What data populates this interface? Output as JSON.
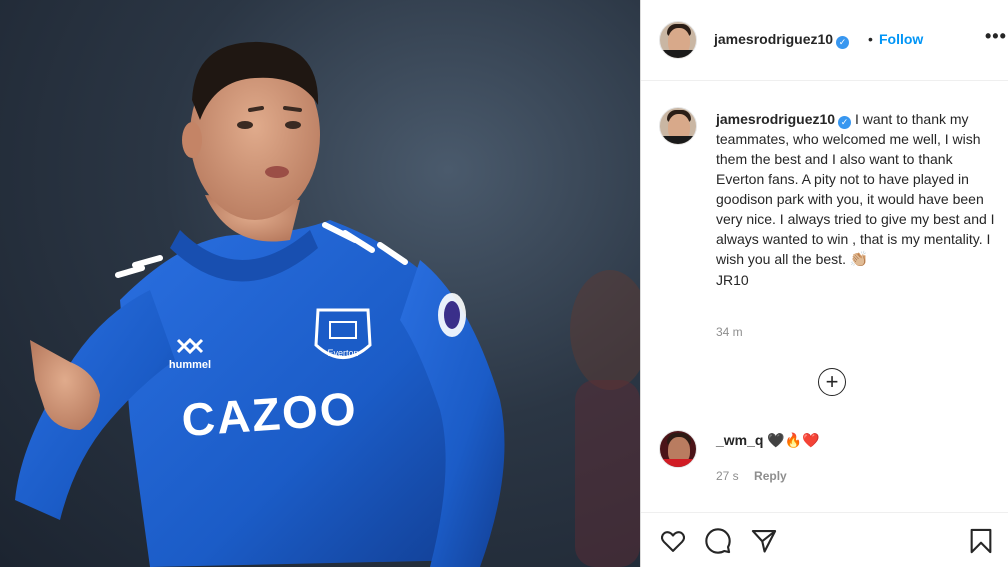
{
  "post": {
    "username": "jamesrodriguez10",
    "verified_icon": "verified-badge-icon",
    "dot": "•",
    "follow_label": "Follow",
    "more_icon": "•••",
    "photo_text": {
      "sponsor": "CAZOO",
      "club_badge": "Everton",
      "kit_brand": "hummel"
    }
  },
  "caption": {
    "username": "jamesrodriguez10",
    "text": "I want to thank my teammates, who welcomed me well, I wish them the best and I also want to thank Everton fans. A pity not to have played in goodison park with you, it would have been very nice. I always tried to give my best and I always wanted to win , that is my mentality. I wish you all the best.",
    "emoji": "👏🏼",
    "signature": "JR10",
    "time": "34 m"
  },
  "load_more": {
    "icon": "plus-circle-icon",
    "symbol": "+"
  },
  "comments": [
    {
      "username": "_wm_q",
      "text": "🖤🔥❤️",
      "time": "27 s",
      "reply_label": "Reply"
    }
  ],
  "actions": {
    "like_icon": "heart-icon",
    "comment_icon": "comment-bubble-icon",
    "share_icon": "paper-plane-icon",
    "save_icon": "bookmark-icon"
  },
  "colors": {
    "link_blue": "#0095f6",
    "verified_blue": "#3897f0",
    "everton_blue": "#1b5cc7",
    "muted": "#8e8e8e"
  }
}
